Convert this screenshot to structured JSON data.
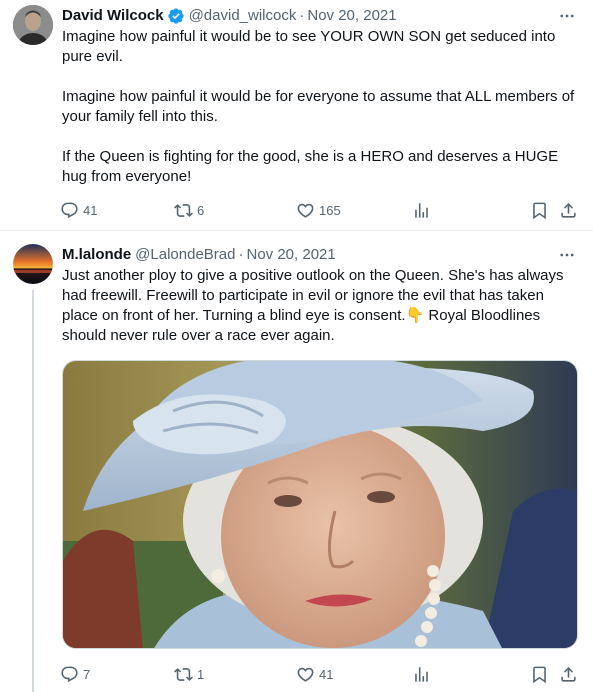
{
  "tweets": [
    {
      "author": {
        "name": "David Wilcock",
        "handle": "@david_wilcock",
        "verified": true
      },
      "date": "Nov 20, 2021",
      "separator": "·",
      "paragraphs": [
        "Imagine how painful it would be to see YOUR OWN SON get seduced into pure evil.",
        "Imagine how painful it would be for everyone to assume that ALL members of your family fell into this.",
        "If the Queen is fighting for the good, she is a HERO and deserves a HUGE hug from everyone!"
      ],
      "stats": {
        "replies": "41",
        "retweets": "6",
        "likes": "165"
      }
    },
    {
      "author": {
        "name": "M.lalonde",
        "handle": "@LalondeBrad",
        "verified": false
      },
      "date": "Nov 20, 2021",
      "separator": "·",
      "paragraphs": [
        "Just another ploy to give a positive outlook on the Queen.  She's has always had freewill.  Freewill to participate in evil or ignore the evil that has taken place on front of her.  Turning a blind eye is consent.👇 Royal Bloodlines should never rule over a race ever again."
      ],
      "media": "photo",
      "stats": {
        "replies": "7",
        "retweets": "1",
        "likes": "41"
      }
    }
  ],
  "colors": {
    "text": "#0f1419",
    "secondary": "#536471",
    "verified_blue": "#1d9bf0",
    "divider": "#eff3f4"
  },
  "icons": [
    "more-icon",
    "reply-icon",
    "retweet-icon",
    "like-icon",
    "views-icon",
    "bookmark-icon",
    "share-icon",
    "verified-icon"
  ]
}
